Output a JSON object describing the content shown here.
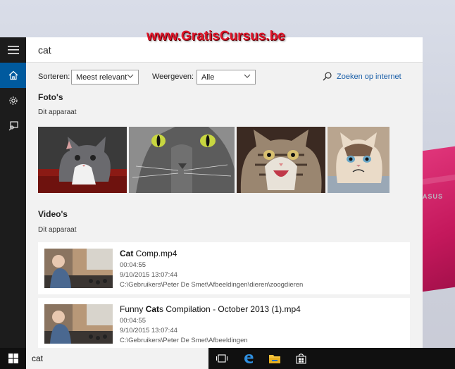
{
  "watermark": "www.GratisCursus.be",
  "desktop": {
    "laptop_logo": "ASUS"
  },
  "rail": {
    "items": [
      {
        "icon": "hamburger-menu-icon"
      },
      {
        "icon": "home-icon",
        "active": true
      },
      {
        "icon": "gear-icon"
      },
      {
        "icon": "feedback-icon"
      }
    ]
  },
  "search": {
    "query": "cat"
  },
  "filters": {
    "sort_label": "Sorteren:",
    "sort_value": "Meest relevant",
    "show_label": "Weergeven:",
    "show_value": "Alle",
    "web_link": "Zoeken op internet"
  },
  "photos": {
    "title": "Foto's",
    "subtitle": "Dit apparaat",
    "items": [
      {
        "name": "kitten-photo"
      },
      {
        "name": "green-eyed-cat-photo"
      },
      {
        "name": "laughing-kitten-photo"
      },
      {
        "name": "grumpy-cat-photo"
      }
    ]
  },
  "videos": {
    "title": "Video's",
    "subtitle": "Dit apparaat",
    "items": [
      {
        "title_bold": "Cat",
        "title_pre": "",
        "title_post": " Comp.mp4",
        "duration": "00:04:55",
        "date": "9/10/2015 13:07:44",
        "path": "C:\\Gebruikers\\Peter De Smet\\Afbeeldingen\\dieren\\zoogdieren"
      },
      {
        "title_bold": "Cat",
        "title_pre": "Funny ",
        "title_post": "s Compilation - October 2013 (1).mp4",
        "duration": "00:04:55",
        "date": "9/10/2015 13:07:44",
        "path": "C:\\Gebruikers\\Peter De Smet\\Afbeeldingen"
      }
    ]
  },
  "taskbar": {
    "search_text": "cat",
    "icons": [
      "windows-start-icon",
      "task-view-icon",
      "edge-icon",
      "file-explorer-icon",
      "store-icon"
    ]
  },
  "colors": {
    "accent": "#005a9e",
    "link": "#1a5fa8",
    "panel": "#f2f2f2",
    "rail": "#1c1c1c",
    "watermark": "#e0162a"
  }
}
